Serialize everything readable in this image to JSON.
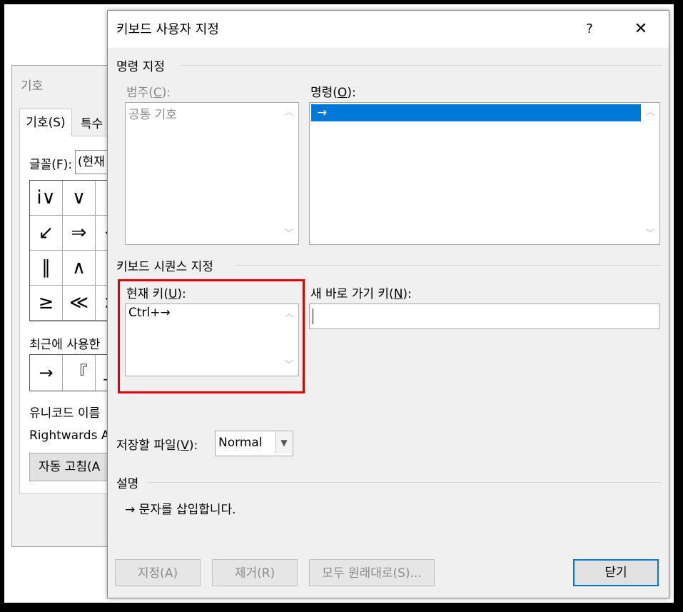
{
  "background_dialog": {
    "title": "기호",
    "tab_symbols": "기호(S)",
    "tab_special": "특수",
    "font_label": "글꼴(F):",
    "font_value": "(현재",
    "symbols": [
      "i∨",
      "∨",
      "∨",
      "↙",
      "⇒",
      "<",
      "∥",
      "∧",
      "∨",
      "≥",
      "≪",
      ">"
    ],
    "recent_label": "최근에 사용한",
    "recent_symbols": [
      "→",
      "『",
      "」"
    ],
    "unicode_label": "유니코드 이름",
    "unicode_value": "Rightwards A",
    "autocorrect_button": "자동 고침(A"
  },
  "dialog": {
    "title": "키보드 사용자 지정",
    "help": "?",
    "close": "✕",
    "command_group": "명령 지정",
    "category_label": "범주(C):",
    "category_items": [
      "공통 기호"
    ],
    "command_label": "명령(O):",
    "command_items": [
      "→"
    ],
    "sequence_group": "키보드 시퀀스 지정",
    "current_keys_label": "현재 키(U):",
    "current_keys": [
      "Ctrl+→"
    ],
    "new_key_label": "새 바로 가기 키(N):",
    "new_key_value": "",
    "save_in_label": "저장할 파일(V):",
    "save_in_value": "Normal",
    "description_group": "설명",
    "description_text": "→ 문자를 삽입합니다.",
    "buttons": {
      "assign": "지정(A)",
      "remove": "제거(R)",
      "reset_all": "모두 원래대로(S)...",
      "close": "닫기"
    }
  },
  "colors": {
    "highlight_box": "#e00000",
    "selection": "#0078d7"
  }
}
